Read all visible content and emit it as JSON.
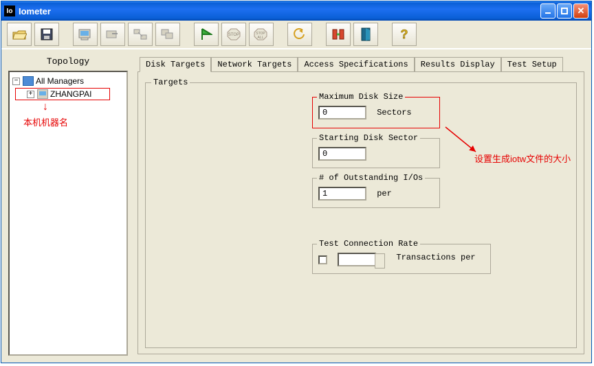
{
  "window": {
    "title": "Iometer"
  },
  "titlebar_icon_text": "Io",
  "toolbar": {
    "buttons": [
      "open",
      "save",
      "disk",
      "remove-worker",
      "net-worker",
      "clone-worker",
      "start",
      "stop",
      "stop-all",
      "reset",
      "config",
      "exit",
      "help"
    ]
  },
  "left": {
    "heading": "Topology",
    "root": "All Managers",
    "manager": "ZHANGPAI",
    "annotation": "本机机器名"
  },
  "tabs": {
    "items": [
      "Disk Targets",
      "Network Targets",
      "Access Specifications",
      "Results Display",
      "Test Setup"
    ],
    "active": 0
  },
  "targets": {
    "legend": "Targets",
    "maxDisk": {
      "title": "Maximum Disk Size",
      "value": "0",
      "unit": "Sectors"
    },
    "startSector": {
      "title": "Starting Disk Sector",
      "value": "0"
    },
    "outstanding": {
      "title": "# of Outstanding I/Os",
      "value": "1",
      "unit": "per"
    },
    "connRate": {
      "title": "Test Connection Rate",
      "unit": "Transactions per"
    }
  },
  "annotations": {
    "right": "设置生成iotw文件的大小"
  }
}
